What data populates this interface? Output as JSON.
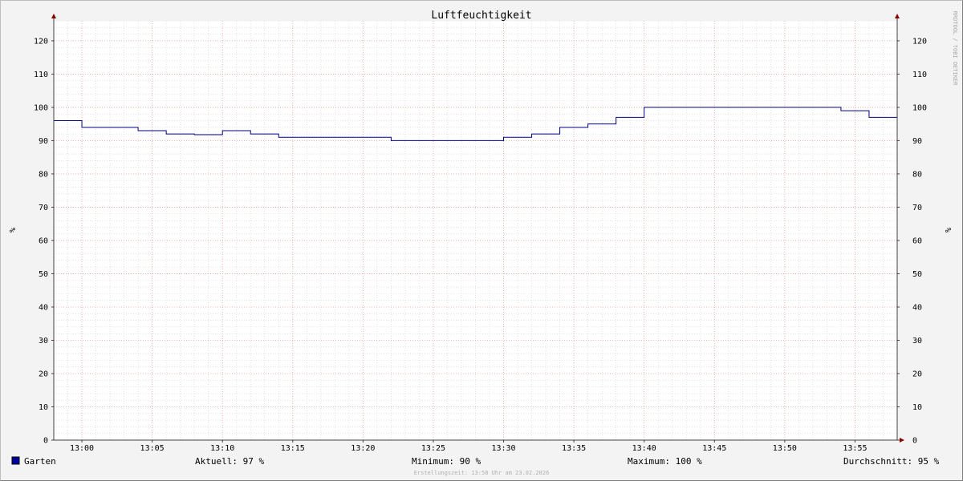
{
  "chart_data": {
    "type": "line",
    "title": "Luftfeuchtigkeit",
    "ylabel": "%",
    "ylabel_right": "%",
    "ylim": [
      0,
      126
    ],
    "yticks": [
      0,
      10,
      20,
      30,
      40,
      50,
      60,
      70,
      80,
      90,
      100,
      110,
      120
    ],
    "xlim": [
      "12:58",
      "13:58"
    ],
    "xtick_labels": [
      "13:00",
      "13:05",
      "13:10",
      "13:15",
      "13:20",
      "13:25",
      "13:30",
      "13:35",
      "13:40",
      "13:45",
      "13:50",
      "13:55"
    ],
    "grid": true,
    "step": true,
    "series": [
      {
        "name": "Garten",
        "color": "#000080",
        "x": [
          "12:58",
          "13:00",
          "13:04",
          "13:06",
          "13:08",
          "13:10",
          "13:12",
          "13:14",
          "13:22",
          "13:30",
          "13:32",
          "13:34",
          "13:36",
          "13:38",
          "13:40",
          "13:54",
          "13:56",
          "13:58"
        ],
        "values": [
          96,
          94,
          93,
          92,
          91.8,
          93,
          92,
          91,
          90,
          91,
          92,
          94,
          95,
          97,
          100,
          99,
          97,
          97
        ]
      }
    ]
  },
  "legend": {
    "series_name": "Garten",
    "swatch_color": "#0000a0",
    "current": "Aktuell:  97 %",
    "minimum": "Minimum:  90 %",
    "maximum": "Maximum: 100 %",
    "average": "Durchschnitt:  95 %"
  },
  "footer": "Erstellungszeit: 13:58 Uhr am 23.02.2026",
  "watermark": "RRDTOOL / TOBI OETIKER",
  "colors": {
    "background": "#f3f3f3",
    "plot_background": "#ffffff",
    "major_grid": "#e8a0a0",
    "minor_grid": "#d0d0d0",
    "axis": "#404040",
    "arrow": "#8b0000"
  }
}
